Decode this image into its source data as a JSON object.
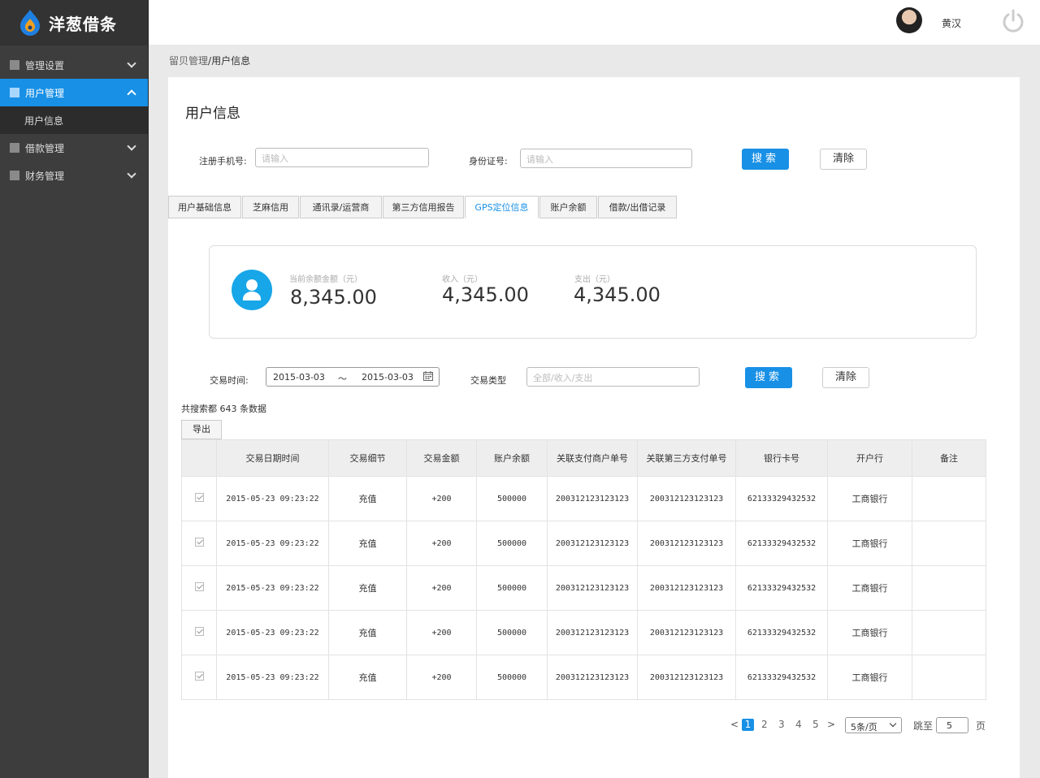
{
  "brand": {
    "name": "洋葱借条"
  },
  "sidebar": {
    "items": [
      {
        "label": "管理设置"
      },
      {
        "label": "用户管理"
      },
      {
        "label": "借款管理"
      },
      {
        "label": "财务管理"
      }
    ],
    "sub_items": [
      {
        "label": "用户信息"
      }
    ]
  },
  "header": {
    "username": "黄汉"
  },
  "breadcrumb": {
    "parent": "留贝管理",
    "separator": "/",
    "current": "用户信息"
  },
  "page": {
    "title": "用户信息"
  },
  "search": {
    "phone_label": "注册手机号:",
    "phone_placeholder": "请输入",
    "id_label": "身份证号:",
    "id_placeholder": "请输入",
    "search_label": "搜索",
    "clear_label": "清除"
  },
  "tabs": [
    {
      "label": "用户基础信息"
    },
    {
      "label": "芝麻信用"
    },
    {
      "label": "通讯录/运营商"
    },
    {
      "label": "第三方信用报告"
    },
    {
      "label": "GPS定位信息"
    },
    {
      "label": "账户余额"
    },
    {
      "label": "借款/出借记录"
    }
  ],
  "summary": {
    "balance_label": "当前余额金额（元）",
    "balance_value": "8,345.00",
    "income_label": "收入（元）",
    "income_value": "4,345.00",
    "expense_label": "支出（元）",
    "expense_value": "4,345.00"
  },
  "filter": {
    "time_label": "交易时间:",
    "date_from": "2015-03-03",
    "date_sep": "～",
    "date_to": "2015-03-03",
    "type_label": "交易类型",
    "type_placeholder": "全部/收入/支出",
    "search_label": "搜索",
    "clear_label": "清除"
  },
  "results": {
    "count_text": "共搜索都 643 条数据",
    "export_label": "导出"
  },
  "table": {
    "headers": [
      "交易日期时间",
      "交易细节",
      "交易金额",
      "账户余额",
      "关联支付商户单号",
      "关联第三方支付单号",
      "银行卡号",
      "开户行",
      "备注"
    ],
    "rows": [
      {
        "datetime": "2015-05-23 09:23:22",
        "detail": "充值",
        "amount": "+200",
        "balance": "500000",
        "merchant_no": "200312123123123",
        "third_no": "200312123123123",
        "card": "62133329432532",
        "bank": "工商银行",
        "note": ""
      },
      {
        "datetime": "2015-05-23 09:23:22",
        "detail": "充值",
        "amount": "+200",
        "balance": "500000",
        "merchant_no": "200312123123123",
        "third_no": "200312123123123",
        "card": "62133329432532",
        "bank": "工商银行",
        "note": ""
      },
      {
        "datetime": "2015-05-23 09:23:22",
        "detail": "充值",
        "amount": "+200",
        "balance": "500000",
        "merchant_no": "200312123123123",
        "third_no": "200312123123123",
        "card": "62133329432532",
        "bank": "工商银行",
        "note": ""
      },
      {
        "datetime": "2015-05-23 09:23:22",
        "detail": "充值",
        "amount": "+200",
        "balance": "500000",
        "merchant_no": "200312123123123",
        "third_no": "200312123123123",
        "card": "62133329432532",
        "bank": "工商银行",
        "note": ""
      },
      {
        "datetime": "2015-05-23 09:23:22",
        "detail": "充值",
        "amount": "+200",
        "balance": "500000",
        "merchant_no": "200312123123123",
        "third_no": "200312123123123",
        "card": "62133329432532",
        "bank": "工商银行",
        "note": ""
      }
    ]
  },
  "pagination": {
    "prev": "<",
    "pages": [
      "1",
      "2",
      "3",
      "4",
      "5"
    ],
    "current": "1",
    "next": ">",
    "page_size": "5条/页",
    "jump_label": "跳至",
    "jump_value": "5",
    "page_unit": "页"
  },
  "colors": {
    "accent": "#1890e6",
    "sidebar_bg": "#3d3d3d",
    "stat_icon": "#17a6e8"
  }
}
